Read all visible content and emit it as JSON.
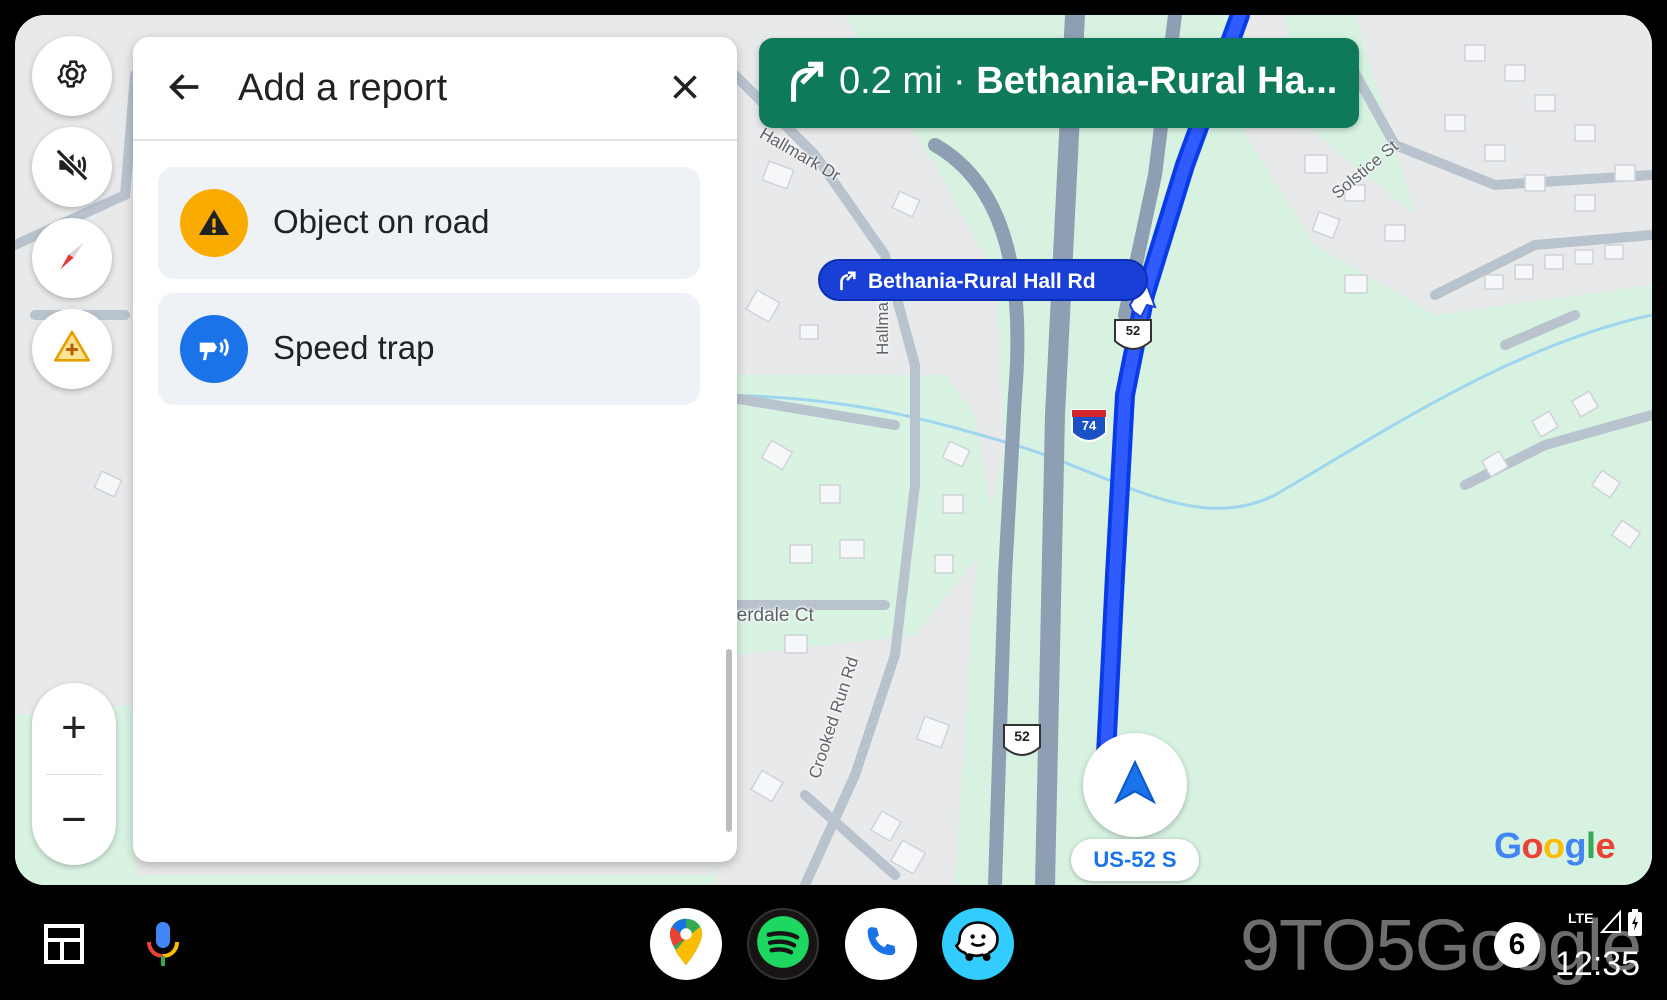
{
  "map": {
    "road_labels": {
      "hallmark_top": "Hallmark Dr",
      "hallmark_mid": "Hallmark Dr",
      "solstice": "Solstice St",
      "summerdale": "mmerdale Ct",
      "crooked_run": "Crooked Run Rd"
    },
    "shields": {
      "us52_top": "52",
      "i74": "74",
      "us52_bottom": "52"
    },
    "current_road": "US-52 S",
    "google_logo": "Google"
  },
  "controls": {
    "settings_icon": "gear-icon",
    "mute_icon": "volume-off-icon",
    "compass_icon": "compass-icon",
    "report_icon": "add-report-icon",
    "zoom_in": "+",
    "zoom_out": "−"
  },
  "report_panel": {
    "title": "Add a report",
    "items": [
      {
        "label": "Object on road",
        "icon": "warning-icon",
        "icon_color": "#f9ab00"
      },
      {
        "label": "Speed trap",
        "icon": "speed-camera-icon",
        "icon_color": "#1a73e8"
      }
    ]
  },
  "navigation": {
    "distance": "0.2 mi",
    "separator": "·",
    "street": "Bethania-Rural Ha...",
    "turn_callout": "Bethania-Rural Hall Rd",
    "banner_color": "#0e7a5a"
  },
  "taskbar": {
    "apps": [
      "Google Maps",
      "Spotify",
      "Phone",
      "Waze"
    ],
    "watermark": "9TO5Google",
    "notification_count": "6",
    "network": "LTE",
    "time": "12:35"
  },
  "colors": {
    "route": "#1a46ff",
    "park": "#d7f2e1",
    "water": "#9fd6ef"
  }
}
